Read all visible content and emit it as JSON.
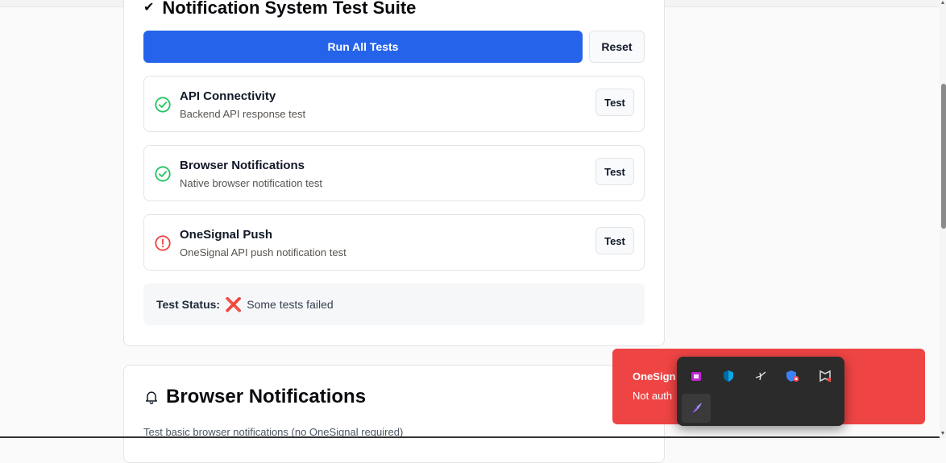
{
  "suite": {
    "title": "Notification System Test Suite",
    "run_all_label": "Run All Tests",
    "reset_label": "Reset",
    "tests": [
      {
        "title": "API Connectivity",
        "subtitle": "Backend API response test",
        "status": "passed",
        "button": "Test"
      },
      {
        "title": "Browser Notifications",
        "subtitle": "Native browser notification test",
        "status": "passed",
        "button": "Test"
      },
      {
        "title": "OneSignal Push",
        "subtitle": "OneSignal API push notification test",
        "status": "failed",
        "button": "Test"
      }
    ],
    "status_label": "Test Status:",
    "status_icon": "❌",
    "status_text": "Some tests failed"
  },
  "browser_card": {
    "title": "Browser Notifications",
    "description": "Test basic browser notifications (no OneSignal required)"
  },
  "toast": {
    "title": "OneSign",
    "message": "Not auth"
  },
  "tray": {
    "icons": [
      "store-icon",
      "shield-icon",
      "sparkle-cursor-icon",
      "security-alert-icon",
      "mcafee-icon",
      "feather-icon"
    ]
  },
  "colors": {
    "primary": "#2563eb",
    "success": "#22c55e",
    "danger": "#ef4444",
    "toast_bg": "#ef4444"
  }
}
